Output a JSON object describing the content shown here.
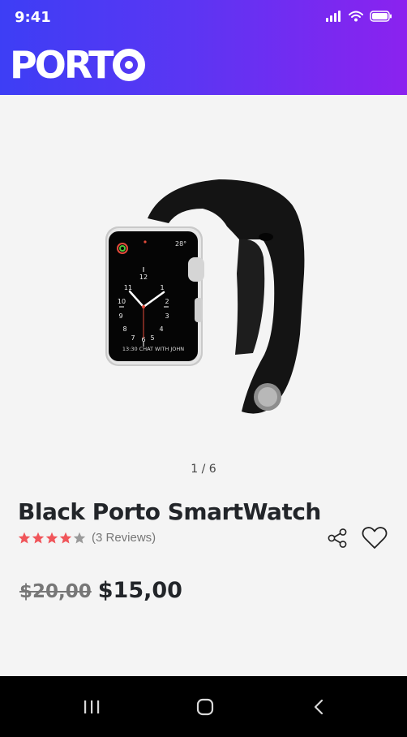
{
  "status_bar": {
    "time": "9:41"
  },
  "header": {
    "logo_text": "PORT"
  },
  "gallery": {
    "counter": "1 / 6"
  },
  "watch_face": {
    "complication": "28°",
    "bottom_text": "13:30 CHAT WITH JOHN"
  },
  "product": {
    "title": "Black Porto SmartWatch",
    "rating": 4,
    "rating_max": 5,
    "reviews": "(3 Reviews)",
    "old_price": "$20,00",
    "new_price": "$15,00"
  },
  "colors": {
    "header_start": "#3d3ef5",
    "header_end": "#8b22ef",
    "star_active": "#f0555a",
    "star_inactive": "#9a9a9a"
  }
}
